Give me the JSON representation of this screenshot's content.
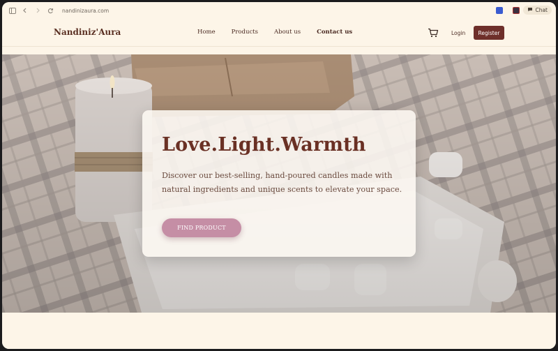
{
  "browser": {
    "url": "nandinizaura.com",
    "chat_label": "Chat"
  },
  "header": {
    "logo": "Nandiniz'Aura",
    "nav": [
      "Home",
      "Products",
      "About us",
      "Contact us"
    ],
    "login": "Login",
    "register": "Register"
  },
  "hero": {
    "title": "Love.Light.Warmth",
    "description": "Discover our best-selling, hand-poured candles made with natural ingredients and unique scents to elevate your space.",
    "cta": "FIND PRODUCT"
  },
  "colors": {
    "brand": "#6e2f2a",
    "cta": "#c58ea5",
    "background": "#fdf5e8"
  }
}
